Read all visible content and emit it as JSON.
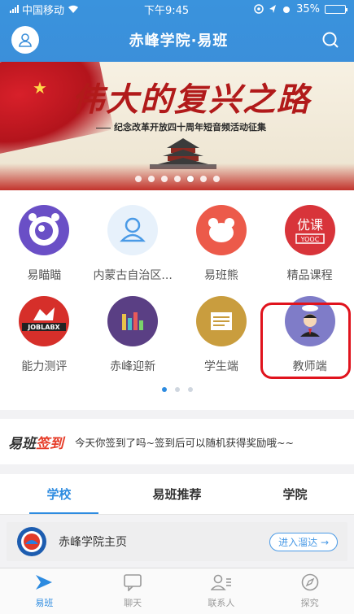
{
  "status_bar": {
    "carrier": "中国移动",
    "time": "下午9:45",
    "battery": "35%",
    "battery_level": 0.35
  },
  "navbar": {
    "title": "赤峰学院·易班"
  },
  "banner": {
    "title": "伟大的复兴之路",
    "subtitle": "纪念改革开放四十周年短音频活动征集",
    "slide_count": 7,
    "active_slide": 4
  },
  "apps": [
    {
      "label": "易瞄瞄",
      "icon": "eye-icon",
      "color": "#6a4fc6"
    },
    {
      "label": "内蒙古自治区...",
      "icon": "person-outline-icon",
      "color": "#e7f1fb"
    },
    {
      "label": "易班熊",
      "icon": "bear-icon",
      "color": "#ec5a4a"
    },
    {
      "label": "精品课程",
      "icon": "yooc-icon",
      "color": "#d8343a",
      "icon_text_top": "优课",
      "icon_text_bottom": "YOOC"
    },
    {
      "label": "能力测评",
      "icon": "joblabx-icon",
      "color": "#d62f2a",
      "icon_text": "JOBLABX"
    },
    {
      "label": "赤峰迎新",
      "icon": "bar-chart-icon",
      "color": "#5a3f84"
    },
    {
      "label": "学生端",
      "icon": "document-icon",
      "color": "#c99d3e"
    },
    {
      "label": "教师端",
      "icon": "teacher-icon",
      "color": "#7f7cc8"
    }
  ],
  "app_pages": {
    "count": 3,
    "active": 0
  },
  "signin": {
    "logo_main": "易班",
    "logo_accent": "签到",
    "text": "今天你签到了吗~签到后可以随机获得奖励哦~~"
  },
  "tabs": [
    {
      "label": "学校",
      "active": true
    },
    {
      "label": "易班推荐",
      "active": false
    },
    {
      "label": "学院",
      "active": false
    }
  ],
  "campus": {
    "name": "赤峰学院主页",
    "enter_label": "进入溜达 →"
  },
  "bottom_tabs": [
    {
      "label": "易班",
      "icon": "yiban-arrow-icon",
      "active": true
    },
    {
      "label": "聊天",
      "icon": "chat-icon",
      "active": false
    },
    {
      "label": "联系人",
      "icon": "contacts-icon",
      "active": false
    },
    {
      "label": "探究",
      "icon": "compass-icon",
      "active": false
    }
  ],
  "colors": {
    "brand_blue": "#3b8fda",
    "highlight_red": "#e0131d"
  }
}
